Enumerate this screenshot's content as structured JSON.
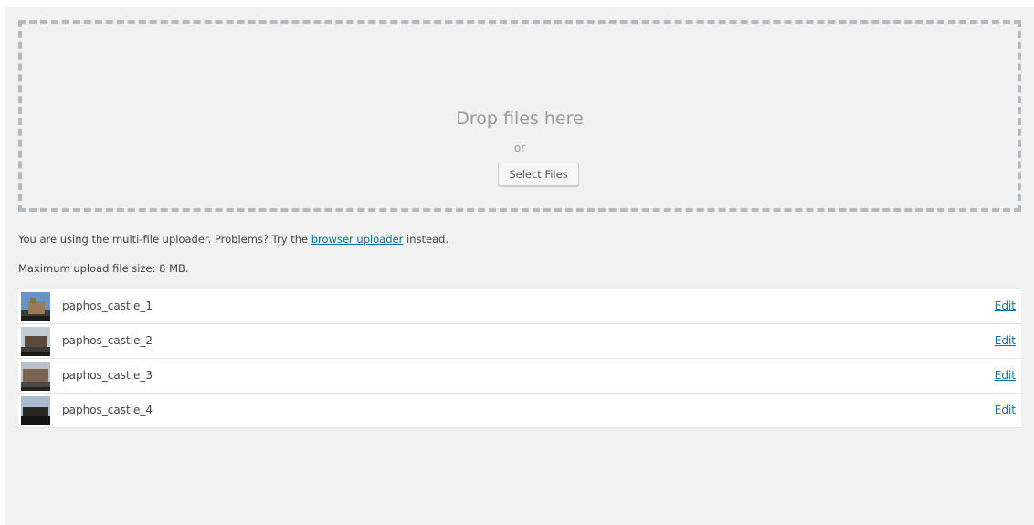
{
  "uploader": {
    "drop_title": "Drop files here",
    "drop_or": "or",
    "select_button": "Select Files",
    "info_prefix": "You are using the multi-file uploader. Problems? Try the",
    "info_link": "browser uploader",
    "info_suffix": "instead.",
    "max_size": "Maximum upload file size: 8 MB."
  },
  "files": [
    {
      "name": "paphos_castle_1",
      "edit_label": "Edit",
      "thumb_icon": "castle-photo-thumbnail"
    },
    {
      "name": "paphos_castle_2",
      "edit_label": "Edit",
      "thumb_icon": "castle-photo-thumbnail"
    },
    {
      "name": "paphos_castle_3",
      "edit_label": "Edit",
      "thumb_icon": "castle-photo-thumbnail"
    },
    {
      "name": "paphos_castle_4",
      "edit_label": "Edit",
      "thumb_icon": "castle-photo-thumbnail"
    }
  ],
  "colors": {
    "background": "#f1f1f1",
    "dashed_border": "#b4b9be",
    "link": "#0073aa",
    "muted_text": "#999999"
  }
}
